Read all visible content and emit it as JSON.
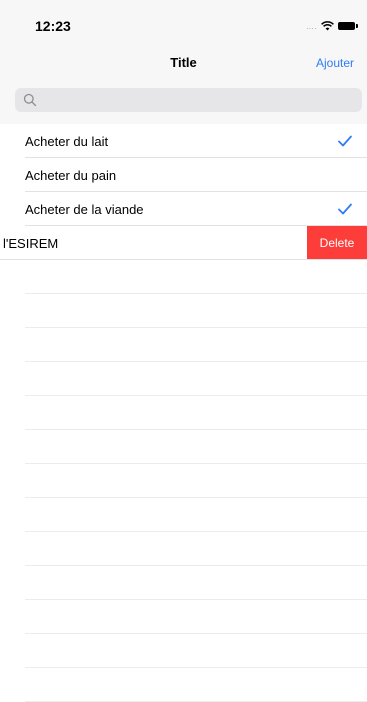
{
  "status_bar": {
    "time": "12:23",
    "signal": "....",
    "wifi_icon": "wifi-icon",
    "battery_icon": "battery-icon"
  },
  "nav": {
    "title": "Title",
    "add_label": "Ajouter"
  },
  "search": {
    "placeholder": "",
    "value": "",
    "icon": "search-icon"
  },
  "colors": {
    "accent": "#2f7cf6",
    "delete": "#fc3d39",
    "bar_bg": "#f7f7f7",
    "separator": "#e2e2e4"
  },
  "list": {
    "items": [
      {
        "label": "Acheter du lait",
        "checked": true
      },
      {
        "label": "Acheter du pain",
        "checked": false
      },
      {
        "label": "Acheter de la viande",
        "checked": true
      },
      {
        "label": "l'ESIREM",
        "checked": false,
        "swiped": true,
        "action_label": "Delete"
      }
    ]
  }
}
